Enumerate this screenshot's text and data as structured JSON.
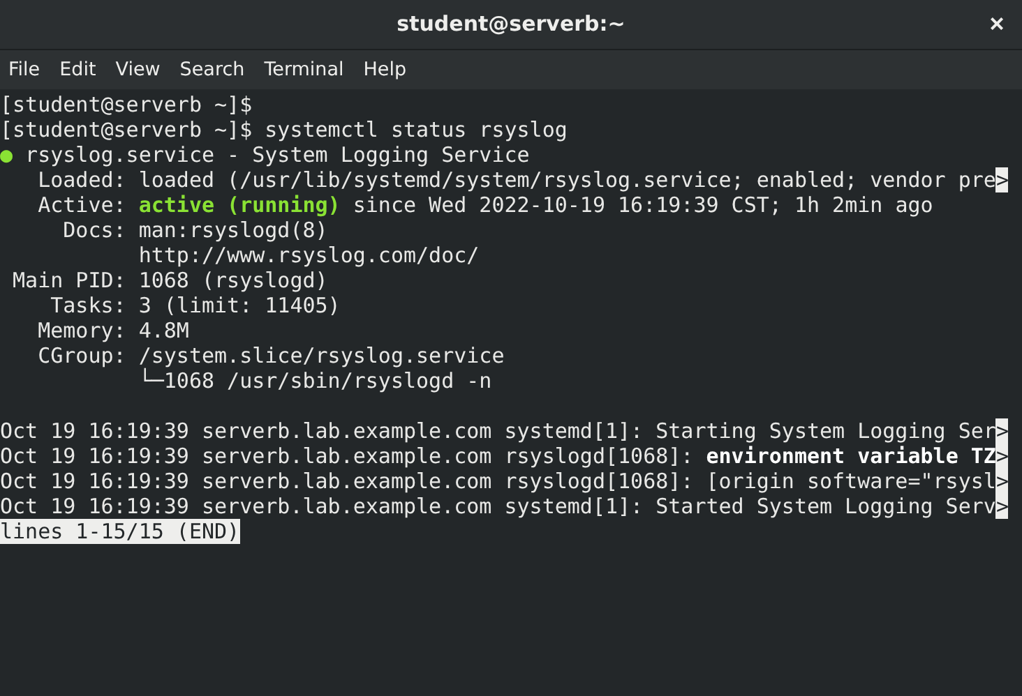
{
  "window": {
    "title": "student@serverb:~",
    "close": "×"
  },
  "menu": [
    "File",
    "Edit",
    "View",
    "Search",
    "Terminal",
    "Help"
  ],
  "lines": [
    {
      "kind": "text",
      "segments": [
        {
          "kind": "normal",
          "text": "[student@serverb ~]$"
        }
      ]
    },
    {
      "kind": "text",
      "segments": [
        {
          "kind": "normal",
          "text": "[student@serverb ~]$ systemctl status rsyslog"
        }
      ]
    },
    {
      "kind": "text",
      "segments": [
        {
          "kind": "dot",
          "text": "●"
        },
        {
          "kind": "normal",
          "text": " rsyslog.service - System Logging Service"
        }
      ]
    },
    {
      "kind": "text",
      "segments": [
        {
          "kind": "normal",
          "text": "   Loaded: loaded (/usr/lib/systemd/system/rsyslog.service; enabled; vendor pre"
        },
        {
          "kind": "reverse",
          "text": ">"
        }
      ]
    },
    {
      "kind": "text",
      "segments": [
        {
          "kind": "normal",
          "text": "   Active: "
        },
        {
          "kind": "green",
          "text": "active (running)"
        },
        {
          "kind": "normal",
          "text": " since Wed 2022-10-19 16:19:39 CST; 1h 2min ago"
        }
      ]
    },
    {
      "kind": "text",
      "segments": [
        {
          "kind": "normal",
          "text": "     Docs: man:rsyslogd(8)"
        }
      ]
    },
    {
      "kind": "text",
      "segments": [
        {
          "kind": "normal",
          "text": "           http://www.rsyslog.com/doc/"
        }
      ]
    },
    {
      "kind": "text",
      "segments": [
        {
          "kind": "normal",
          "text": " Main PID: 1068 (rsyslogd)"
        }
      ]
    },
    {
      "kind": "text",
      "segments": [
        {
          "kind": "normal",
          "text": "    Tasks: 3 (limit: 11405)"
        }
      ]
    },
    {
      "kind": "text",
      "segments": [
        {
          "kind": "normal",
          "text": "   Memory: 4.8M"
        }
      ]
    },
    {
      "kind": "text",
      "segments": [
        {
          "kind": "normal",
          "text": "   CGroup: /system.slice/rsyslog.service"
        }
      ]
    },
    {
      "kind": "text",
      "segments": [
        {
          "kind": "normal",
          "text": "           └─1068 /usr/sbin/rsyslogd -n"
        }
      ]
    },
    {
      "kind": "blank"
    },
    {
      "kind": "text",
      "segments": [
        {
          "kind": "normal",
          "text": "Oct 19 16:19:39 serverb.lab.example.com systemd[1]: Starting System Logging Ser"
        },
        {
          "kind": "reverse",
          "text": ">"
        }
      ]
    },
    {
      "kind": "text",
      "segments": [
        {
          "kind": "normal",
          "text": "Oct 19 16:19:39 serverb.lab.example.com rsyslogd[1068]: "
        },
        {
          "kind": "bold",
          "text": "environment variable TZ"
        },
        {
          "kind": "reverse",
          "text": ">"
        }
      ]
    },
    {
      "kind": "text",
      "segments": [
        {
          "kind": "normal",
          "text": "Oct 19 16:19:39 serverb.lab.example.com rsyslogd[1068]: [origin software=\"rsysl"
        },
        {
          "kind": "reverse",
          "text": ">"
        }
      ]
    },
    {
      "kind": "text",
      "segments": [
        {
          "kind": "normal",
          "text": "Oct 19 16:19:39 serverb.lab.example.com systemd[1]: Started System Logging Serv"
        },
        {
          "kind": "reverse",
          "text": ">"
        }
      ]
    },
    {
      "kind": "text",
      "segments": [
        {
          "kind": "reverse",
          "text": "lines 1-15/15 (END)"
        }
      ]
    }
  ]
}
